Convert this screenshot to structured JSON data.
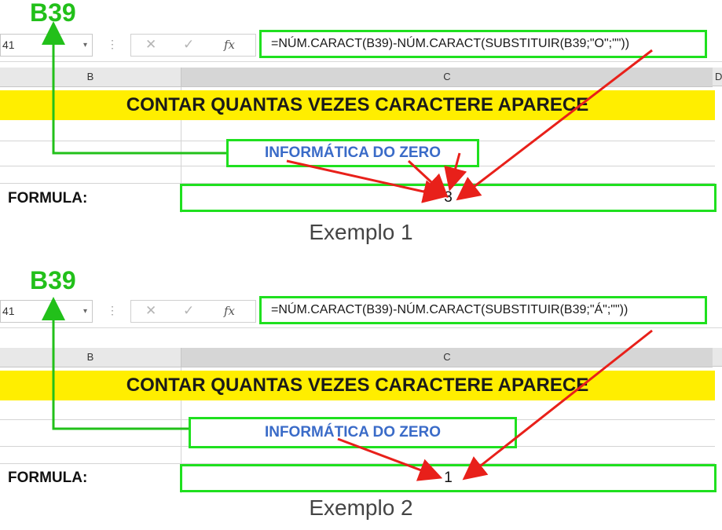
{
  "examples": [
    {
      "cell_ref": "B39",
      "namebox": "41",
      "formula": "=NÚM.CARACT(B39)-NÚM.CARACT(SUBSTITUIR(B39;\"O\";\"\"))",
      "col_headers": [
        "B",
        "C",
        "D"
      ],
      "title": "CONTAR QUANTAS VEZES CARACTERE APARECE",
      "source_text": "INFORMÁTICA DO ZERO",
      "formula_label": "FORMULA:",
      "result": "3",
      "caption": "Exemplo 1"
    },
    {
      "cell_ref": "B39",
      "namebox": "41",
      "formula": "=NÚM.CARACT(B39)-NÚM.CARACT(SUBSTITUIR(B39;\"Á\";\"\"))",
      "col_headers": [
        "B",
        "C",
        ""
      ],
      "title": "CONTAR QUANTAS VEZES CARACTERE APARECE",
      "source_text": "INFORMÁTICA DO ZERO",
      "formula_label": "FORMULA:",
      "result": "1",
      "caption": "Exemplo 2"
    }
  ],
  "icons": {
    "cancel": "✕",
    "enter": "✓",
    "fx": "fx",
    "dropdown": "▾"
  },
  "colors": {
    "highlight_green": "#1fe01f",
    "annotation_green": "#22c01a",
    "arrow_red": "#e8201a",
    "title_yellow": "#ffee00",
    "source_text_blue": "#3a6bc8"
  }
}
